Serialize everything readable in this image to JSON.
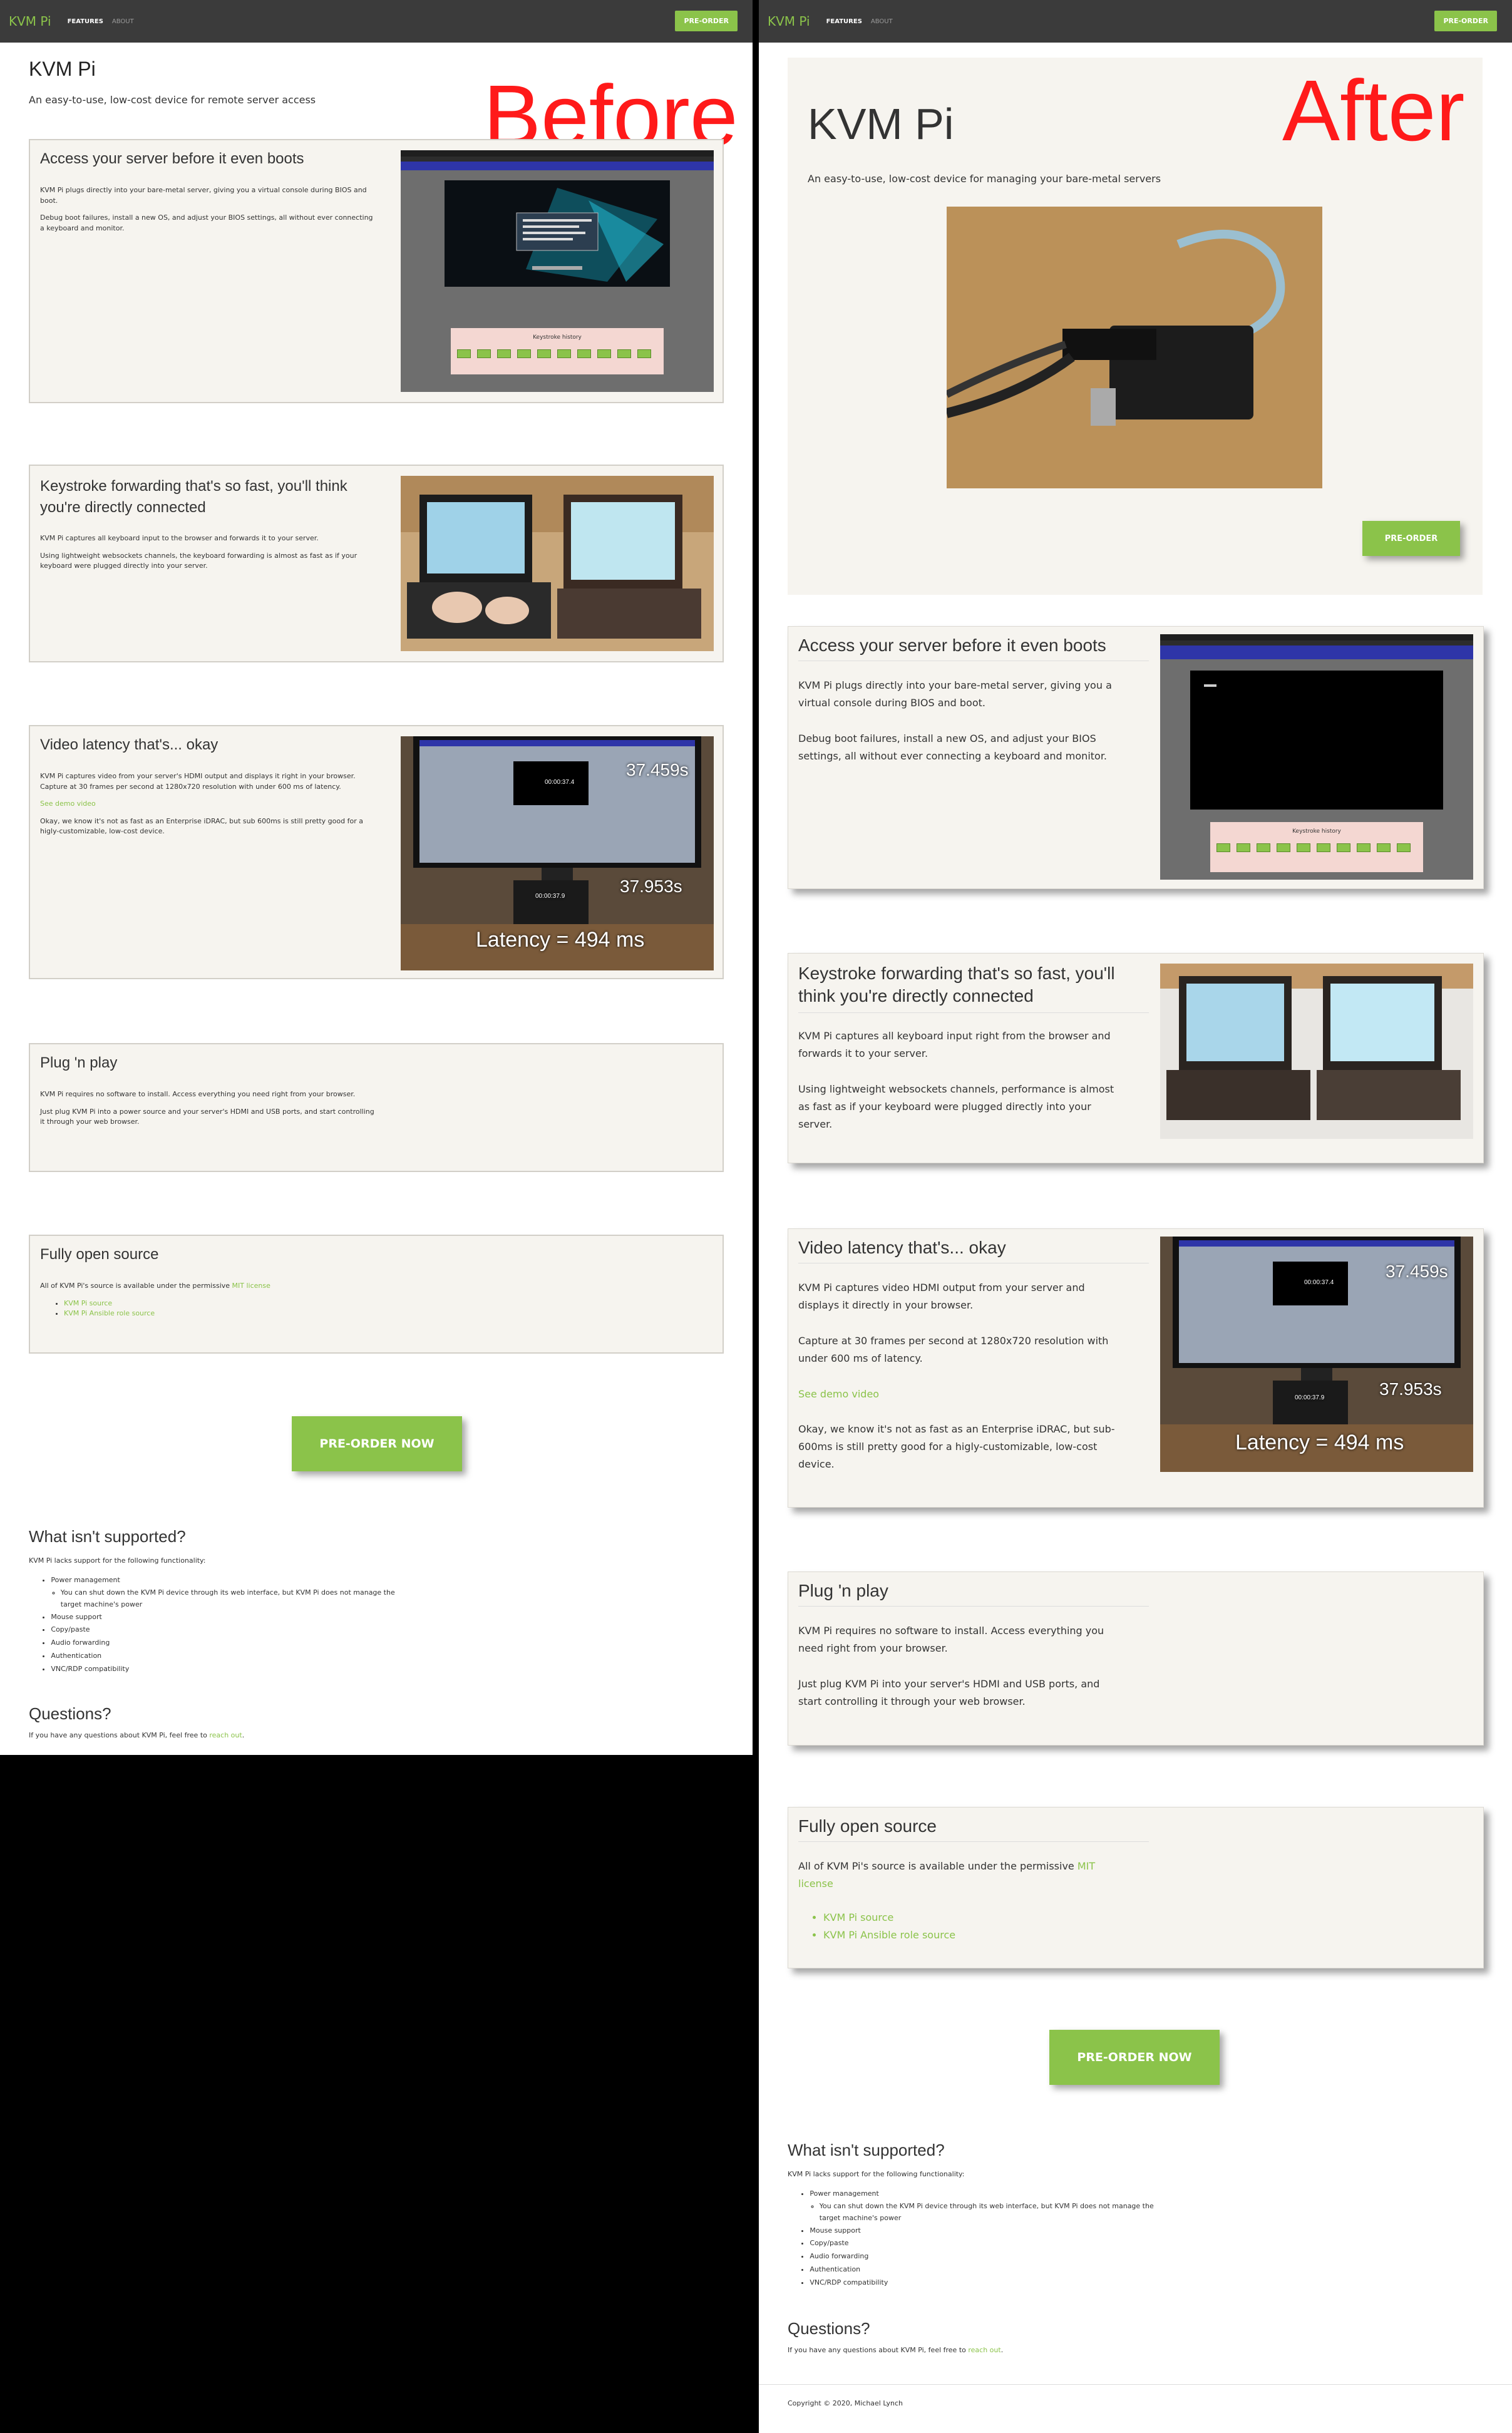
{
  "labels": {
    "before": "Before",
    "after": "After"
  },
  "nav": {
    "brand": "KVM Pi",
    "features": "FEATURES",
    "about": "ABOUT",
    "preorder": "PRE-ORDER"
  },
  "hero": {
    "title": "KVM Pi",
    "subtitle_before": "An easy-to-use, low-cost device for remote server access",
    "subtitle_after": "An easy-to-use, low-cost device for managing your bare-metal servers",
    "button": "PRE-ORDER"
  },
  "before": {
    "features": [
      {
        "title": "Access your server before it even boots",
        "p1": "KVM Pi plugs directly into your bare-metal server, giving you a virtual console during BIOS and boot.",
        "p2": "Debug boot failures, install a new OS, and adjust your BIOS settings, all without ever connecting a keyboard and monitor."
      },
      {
        "title": "Keystroke forwarding that's so fast, you'll think you're directly connected",
        "p1": "KVM Pi captures all keyboard input to the browser and forwards it to your server.",
        "p2": "Using lightweight websockets channels, the keyboard forwarding is almost as fast as if your keyboard were plugged directly into your server."
      },
      {
        "title": "Video latency that's... okay",
        "p1": "KVM Pi captures video from your server's HDMI output and displays it right in your browser. Capture at 30 frames per second at 1280x720 resolution with under 600 ms of latency.",
        "link": "See demo video",
        "p2": "Okay, we know it's not as fast as an Enterprise iDRAC, but sub 600ms is still pretty good for a higly-customizable, low-cost device."
      },
      {
        "title": "Plug 'n play",
        "p1": "KVM Pi requires no software to install. Access everything you need right from your browser.",
        "p2": "Just plug KVM Pi into a power source and your server's HDMI and USB ports, and start controlling it through your web browser."
      }
    ]
  },
  "after": {
    "features": [
      {
        "title": "Access your server before it even boots",
        "p1": "KVM Pi plugs directly into your bare-metal server, giving you a virtual console during BIOS and boot.",
        "p2": "Debug boot failures, install a new OS, and adjust your BIOS settings, all without ever connecting a keyboard and monitor."
      },
      {
        "title": "Keystroke forwarding that's so fast, you'll think you're directly connected",
        "p1": "KVM Pi captures all keyboard input right from the browser and forwards it to your server.",
        "p2": "Using lightweight websockets channels, performance is almost as fast as if your keyboard were plugged directly into your server."
      },
      {
        "title": "Video latency that's... okay",
        "p1": "KVM Pi captures video HDMI output from your server and displays it directly in your browser.",
        "p2": "Capture at 30 frames per second at 1280x720 resolution with under 600 ms of latency.",
        "link": "See demo video",
        "p3": "Okay, we know it's not as fast as an Enterprise iDRAC, but sub-600ms is still pretty good for a higly-customizable, low-cost device."
      },
      {
        "title": "Plug 'n play",
        "p1": "KVM Pi requires no software to install. Access everything you need right from your browser.",
        "p2": "Just plug KVM Pi into your server's HDMI and USB ports, and start controlling it through your web browser."
      }
    ]
  },
  "opensource": {
    "title": "Fully open source",
    "text": "All of KVM Pi's source is available under the permissive",
    "license": "MIT license",
    "src1": "KVM Pi source",
    "src2": "KVM Pi Ansible role source"
  },
  "cta": "PRE-ORDER NOW",
  "unsupported": {
    "title": "What isn't supported?",
    "intro": "KVM Pi lacks support for the following functionality:",
    "items": [
      "Power management",
      "Mouse support",
      "Copy/paste",
      "Audio forwarding",
      "Authentication",
      "VNC/RDP compatibility"
    ],
    "sub": "You can shut down the KVM Pi device through its web interface, but KVM Pi does not manage the target machine's power"
  },
  "questions": {
    "title": "Questions?",
    "text": "If you have any questions about KVM Pi, feel free to",
    "link": "reach out",
    "end": "."
  },
  "footer": "Copyright © 2020, Michael Lynch",
  "screens": {
    "kbd_history": "Keystroke history",
    "latency": "Latency = 494 ms",
    "t1": "37.459s",
    "t2": "37.953s",
    "clock1": "00:00:37.4",
    "clock2": "00:00:37.9"
  },
  "colors": {
    "accent": "#8bc34a",
    "navbar": "#3b3b3b",
    "card": "#f6f4ef"
  }
}
